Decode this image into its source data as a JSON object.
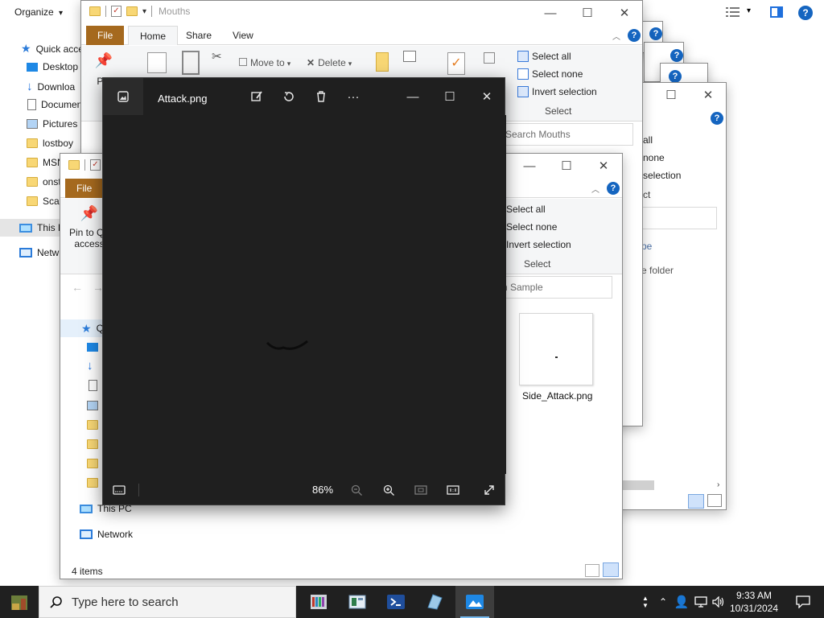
{
  "desktop_toolbar": {
    "organize_label": "Organize",
    "chevron": "▾",
    "help_glyph": "?"
  },
  "left_nav": {
    "items": [
      {
        "label": "Quick acce",
        "icon": "star-icon"
      },
      {
        "label": "Desktop",
        "icon": "desktop-icon"
      },
      {
        "label": "Downloa",
        "icon": "download-icon"
      },
      {
        "label": "Documen",
        "icon": "document-icon"
      },
      {
        "label": "Pictures",
        "icon": "pictures-icon"
      },
      {
        "label": "lostboy",
        "icon": "folder-icon"
      },
      {
        "label": "MSN",
        "icon": "folder-icon"
      },
      {
        "label": "onst",
        "icon": "folder-icon"
      },
      {
        "label": "Scar",
        "icon": "folder-icon"
      },
      {
        "label": "This P",
        "icon": "this-pc-icon"
      },
      {
        "label": "Netw",
        "icon": "network-icon"
      }
    ]
  },
  "mouths_window": {
    "title": "Mouths",
    "tabs": [
      "File",
      "Home",
      "Share",
      "View"
    ],
    "buttons": {
      "pin": "Pin",
      "move_to": "Move to",
      "delete": "Delete"
    },
    "select_group": {
      "select_all": "Select all",
      "select_none": "Select none",
      "invert_selection": "Invert selection",
      "label": "Select"
    },
    "search_placeholder": "Search Mouths"
  },
  "back_window_2": {
    "select_all_partial": "all",
    "select_none_partial": "none",
    "invert_partial": "selection",
    "select_label_partial": "ct",
    "type_partial": "pe",
    "folder_partial": "e folder"
  },
  "sample_window": {
    "tabs": [
      "File"
    ],
    "pin_to_quick": "Pin to Qu",
    "pin_to_quick_2": "access",
    "select_group": {
      "select_all": "Select all",
      "select_none": "Select none",
      "invert_selection": "Invert selection",
      "label": "Select"
    },
    "search_placeholder": "n Sample",
    "file": {
      "name": "Side_Attack.png"
    },
    "nav": {
      "quick_partial": "Q",
      "this_pc": "This PC",
      "network": "Network"
    },
    "status": "4 items"
  },
  "photo_viewer": {
    "file_name": "Attack.png",
    "zoom": "86%",
    "more_glyph": "···"
  },
  "taskbar": {
    "search_placeholder": "Type here to search",
    "time": "9:33 AM",
    "date": "10/31/2024"
  }
}
